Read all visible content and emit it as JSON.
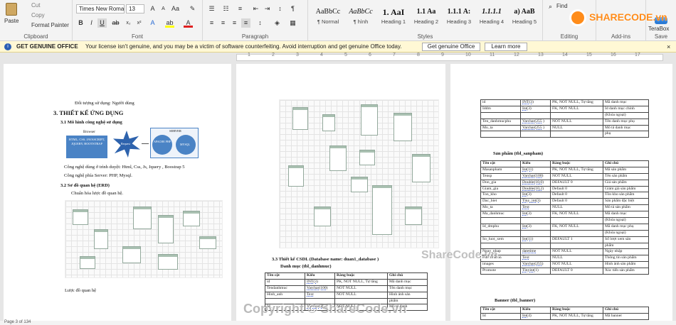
{
  "ribbon": {
    "clipboard": {
      "paste": "Paste",
      "cut": "Cut",
      "copy": "Copy",
      "format_painter": "Format Painter",
      "label": "Clipboard"
    },
    "font": {
      "family": "Times New Roman",
      "size": "13",
      "label": "Font"
    },
    "paragraph": {
      "label": "Paragraph"
    },
    "styles": {
      "label": "Styles",
      "items": [
        {
          "sample": "AaBbCc",
          "name": "¶ Normal"
        },
        {
          "sample": "AaBbCc",
          "name": "¶ hình"
        },
        {
          "sample": "1. AaI",
          "name": "Heading 1"
        },
        {
          "sample": "1.1 Aa",
          "name": "Heading 2"
        },
        {
          "sample": "1.1.1 A:",
          "name": "Heading 3"
        },
        {
          "sample": "1.1.1.1",
          "name": "Heading 4"
        },
        {
          "sample": "a) AaB",
          "name": "Heading 5"
        }
      ]
    },
    "editing": {
      "find": "Find",
      "label": "Editing"
    },
    "addins": {
      "label": "Add-ins"
    },
    "save": {
      "terabox": "TeraBox",
      "label": "Save"
    }
  },
  "banner": {
    "title": "GET GENUINE OFFICE",
    "message": "Your license isn't genuine, and you may be a victim of software counterfeiting. Avoid interruption and get genuine Office today.",
    "btn_genuine": "Get genuine Office",
    "btn_learn": "Learn more"
  },
  "ruler": {
    "numbers": [
      "1",
      "2",
      "3",
      "4",
      "5",
      "6",
      "7",
      "8",
      "9",
      "10",
      "11",
      "12",
      "13",
      "14",
      "15",
      "16",
      "17"
    ]
  },
  "page1": {
    "line1": "Đối tượng sử dụng: Người dùng",
    "h3": "3. THIẾT KẾ ỨNG DỤNG",
    "h31": "3.1 Mô hình công nghệ sử dụng",
    "browser": "Browser",
    "browser_tech": "HTML, CSS, JAVASCRIPT, JQUERY, BOOTSTRAP",
    "request": "Request",
    "server": "SERVER",
    "apache": "APACHE PHP",
    "mysql": "MYSQL",
    "tech_browser": "Công nghệ dùng ở trình duyệt: Html, Css, Js, Jquery , Boostrap 5",
    "tech_server": "Công nghệ phía Server: PHP, Mysql.",
    "h32": "3.2 Sơ đồ quan hệ (ERD)",
    "erd_norm": "Chuẩn hóa lược đồ quan hệ.",
    "erd_caption": "Lược đồ quan hệ"
  },
  "page2": {
    "h33": "3.3 Thiết kế CSDL (Database name: duan1_database )",
    "sub": "Danh mục (tbl_danhmuc)",
    "headers": [
      "Tên cột",
      "Kiểu",
      "Ràng buộc",
      "Ghi chú"
    ],
    "rows": [
      [
        "id",
        "INT(3)",
        "PK, NOT NULL, Tự tăng",
        "Mã danh mục"
      ],
      [
        "Tendanhmuc",
        "Varchar(100)",
        "NOT NULL",
        "Tên danh mục"
      ],
      [
        "Hinh_anh",
        "Text",
        "NOT NULL",
        "Hình ảnh sản"
      ],
      [
        "",
        "",
        "",
        "phẩm"
      ],
      [
        "Id_",
        "Varchar(255)",
        "NOT NULL",
        "Mô tả danh"
      ]
    ]
  },
  "page3": {
    "table1": [
      [
        "id",
        "INT(3)",
        "PK, NOT NULL, Tự tăng",
        "Mã danh mục"
      ],
      [
        "Iddm",
        "Int(3)",
        "FK, NOT NULL",
        "Id danh mục chính"
      ],
      [
        "",
        "",
        "",
        "(Khóa ngoại)"
      ],
      [
        "Ten_danhmucphu",
        "Varchar(255 )",
        "NOT NULL",
        "Tên danh mục phụ"
      ],
      [
        "Mo_ta",
        "Varchar(255 )",
        "NULL",
        "Mô tả danh mục"
      ],
      [
        "",
        "",
        "",
        "phụ"
      ]
    ],
    "sanpham_title": "Sản phẩm (tbl_sanpham)",
    "headers": [
      "Tên cột",
      "Kiểu",
      "Ràng buộc",
      "Ghi chú"
    ],
    "sanpham": [
      [
        "Masanpham",
        "Int(11)",
        "PK, NOT NULL, Tự tăng",
        "Mã sản phẩm"
      ],
      [
        "Tensp",
        "Varchar(100)",
        "NOT NULL",
        "Tên sản phẩm"
      ],
      [
        "Don_gia",
        "Double(10,0)",
        "DEFAULT 0",
        "Giá sản phẩm"
      ],
      [
        "Giam_gia",
        "Double(10,2)",
        "Default 0",
        "Giảm giá sản phẩm"
      ],
      [
        "Ton_kho",
        "Int(3)",
        "Default 0",
        "Tồn kho sản phẩm"
      ],
      [
        "Dac_biet",
        "Tiny_int(3)",
        "Default 0",
        "Sản phẩm đặc biệt"
      ],
      [
        "Mo_ta",
        "Text",
        "NULL",
        "Mô tả sản phẩm"
      ],
      [
        "Ma_danhmuc",
        "Int(3)",
        "FK, NOT NULL",
        "Mã danh mục"
      ],
      [
        "",
        "",
        "",
        "(Khóa ngoại)"
      ],
      [
        "Id_dmphu",
        "Int(3)",
        "FK, NOT NULL",
        "Mã danh mục phụ"
      ],
      [
        "",
        "",
        "",
        "(Khóa ngoại)"
      ],
      [
        "So_luot_xem",
        "Int(11)",
        "DEFAULT 1",
        "Số lượt xem sản"
      ],
      [
        "",
        "",
        "",
        "phẩm"
      ],
      [
        "Ngay_nhap",
        "datetime",
        "NOT NULL",
        "Ngày nhập"
      ],
      [
        "Information",
        "Text",
        "NULL",
        "Thông tin sản phẩm"
      ],
      [
        "images",
        "Varchar(255)",
        "NOT NULL",
        "Hình ảnh sản phẩm"
      ],
      [
        "Promote",
        "Tinyint(1)",
        "DEFAULT 0",
        "Xúc tiến sản phẩm"
      ]
    ],
    "banner_title": "Banner (tbl_banner)",
    "banner_rows": [
      [
        "Id",
        "Int(4)",
        "PK, NOT NULL, Tự tăng",
        "Mã banner"
      ]
    ]
  },
  "watermarks": {
    "logo": "SHARECODE.vn",
    "center": "ShareCode.vn",
    "bottom": "Copyright © ShareCode.vn"
  },
  "status": {
    "page": "Page 3 of 134"
  }
}
